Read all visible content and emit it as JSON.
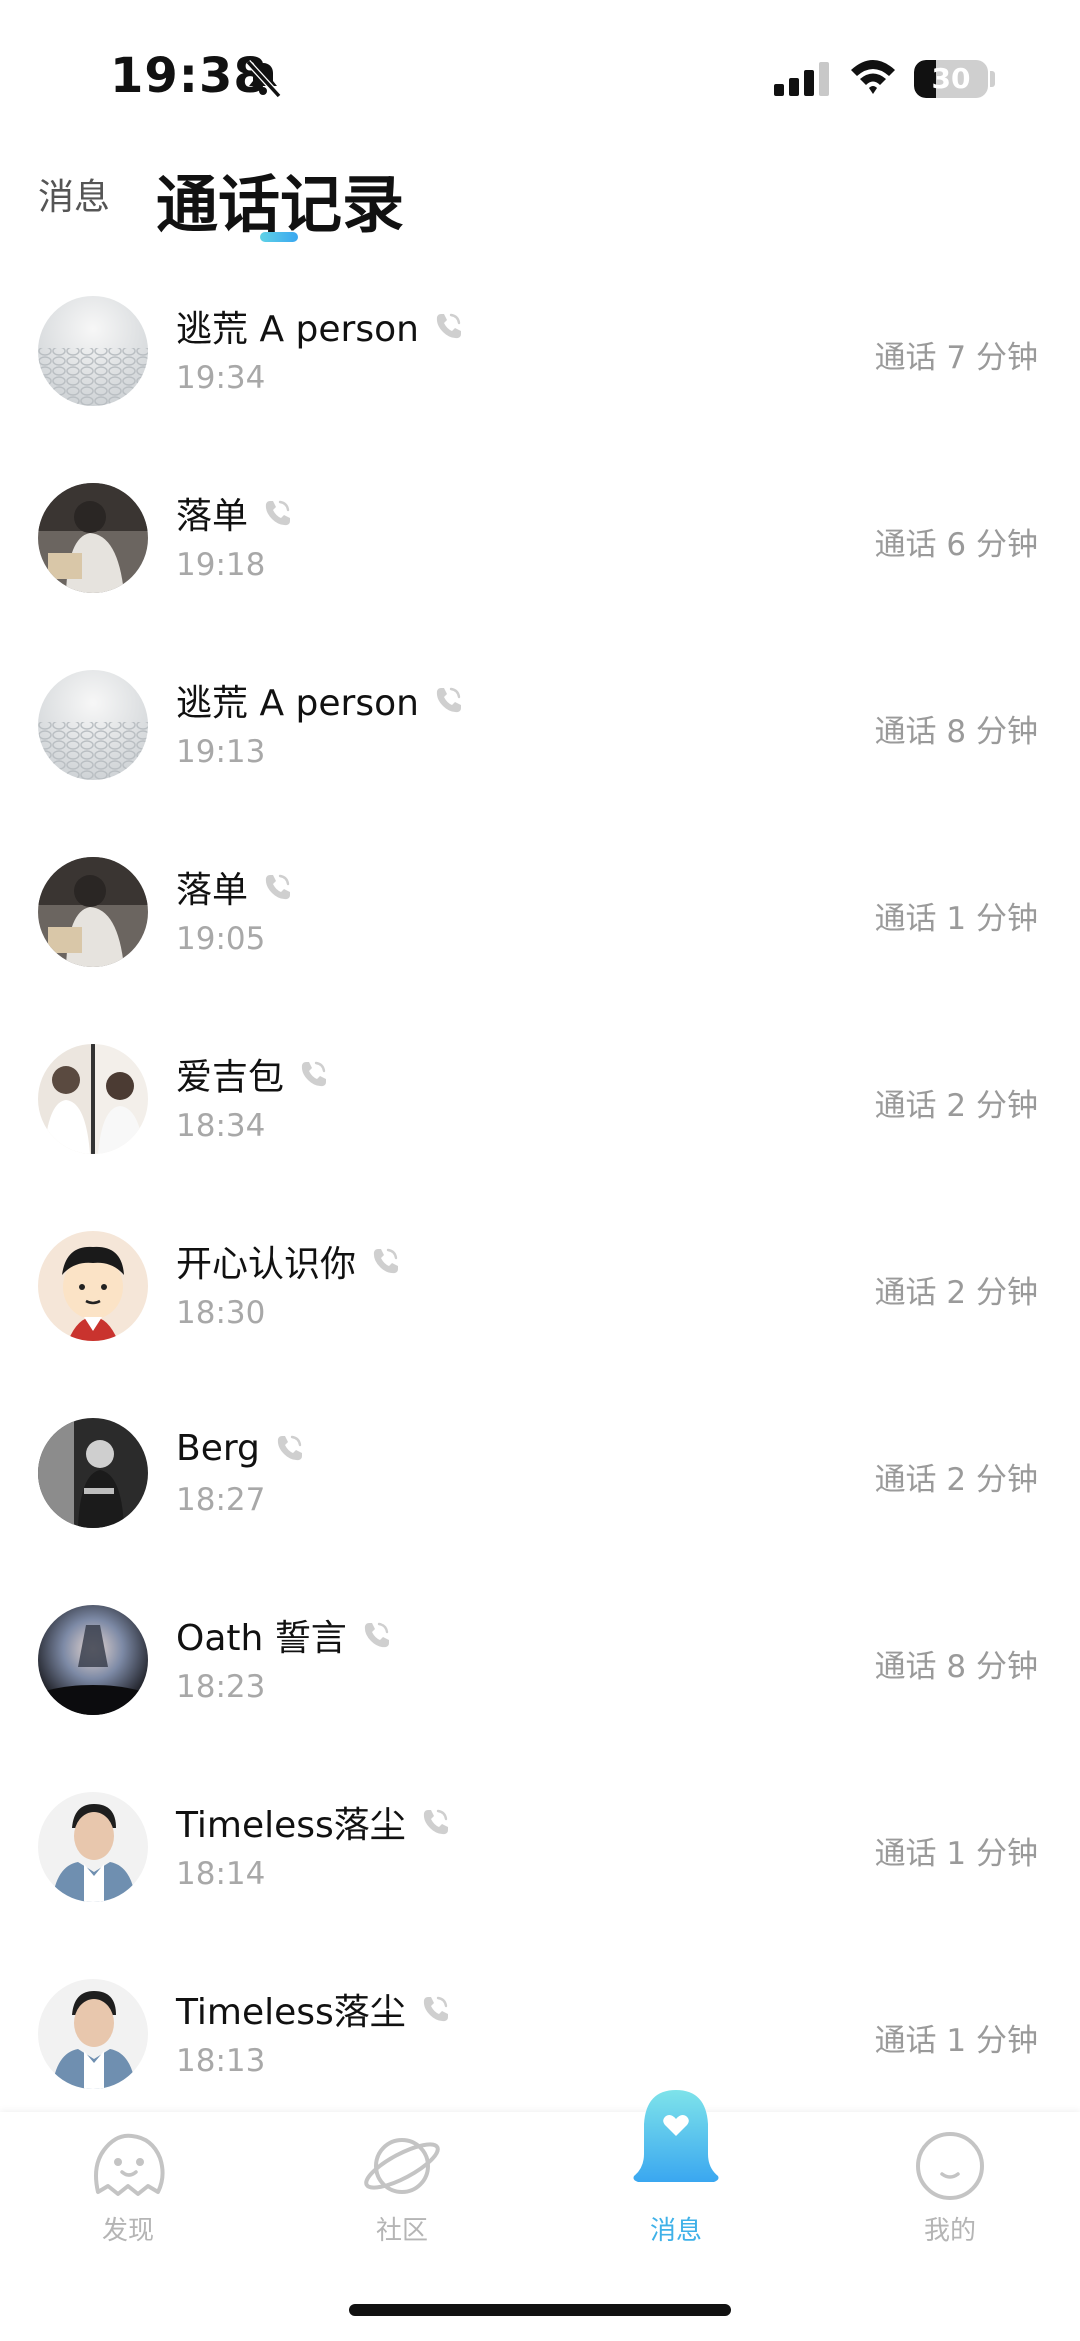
{
  "status_bar": {
    "time": "19:38",
    "battery_level": "30",
    "battery_fraction": 0.3
  },
  "header": {
    "tab_messages": "消息",
    "tab_calls": "通话记录"
  },
  "calls": [
    {
      "name": "逃荒 A person",
      "time": "19:34",
      "duration": "通话 7 分钟",
      "avatar": "textured-white-avatar"
    },
    {
      "name": "落单",
      "time": "19:18",
      "duration": "通话 6 分钟",
      "avatar": "person-reading-avatar"
    },
    {
      "name": "逃荒 A person",
      "time": "19:13",
      "duration": "通话 8 分钟",
      "avatar": "textured-white-avatar"
    },
    {
      "name": "落单",
      "time": "19:05",
      "duration": "通话 1 分钟",
      "avatar": "person-reading-avatar"
    },
    {
      "name": "爱吉包",
      "time": "18:34",
      "duration": "通话 2 分钟",
      "avatar": "split-photo-avatar"
    },
    {
      "name": "开心认识你",
      "time": "18:30",
      "duration": "通话 2 分钟",
      "avatar": "cartoon-boy-avatar"
    },
    {
      "name": "Berg",
      "time": "18:27",
      "duration": "通话 2 分钟",
      "avatar": "bw-portrait-avatar"
    },
    {
      "name": "Oath 誓言",
      "time": "18:23",
      "duration": "通话 8 分钟",
      "avatar": "dark-gradient-avatar"
    },
    {
      "name": "Timeless落尘",
      "time": "18:14",
      "duration": "通话 1 分钟",
      "avatar": "man-portrait-avatar"
    },
    {
      "name": "Timeless落尘",
      "time": "18:13",
      "duration": "通话 1 分钟",
      "avatar": "man-portrait-avatar"
    }
  ],
  "bottom_nav": [
    {
      "label": "发现",
      "icon": "ghost-face-icon",
      "active": false
    },
    {
      "label": "社区",
      "icon": "planet-icon",
      "active": false
    },
    {
      "label": "消息",
      "icon": "bell-heart-icon",
      "active": true
    },
    {
      "label": "我的",
      "icon": "smile-face-icon",
      "active": false
    }
  ],
  "colors": {
    "accent": "#3fb1e8",
    "accent_light": "#5fd2e6",
    "muted_text": "#a8a8a8",
    "nav_inactive": "#b5b5b5"
  }
}
